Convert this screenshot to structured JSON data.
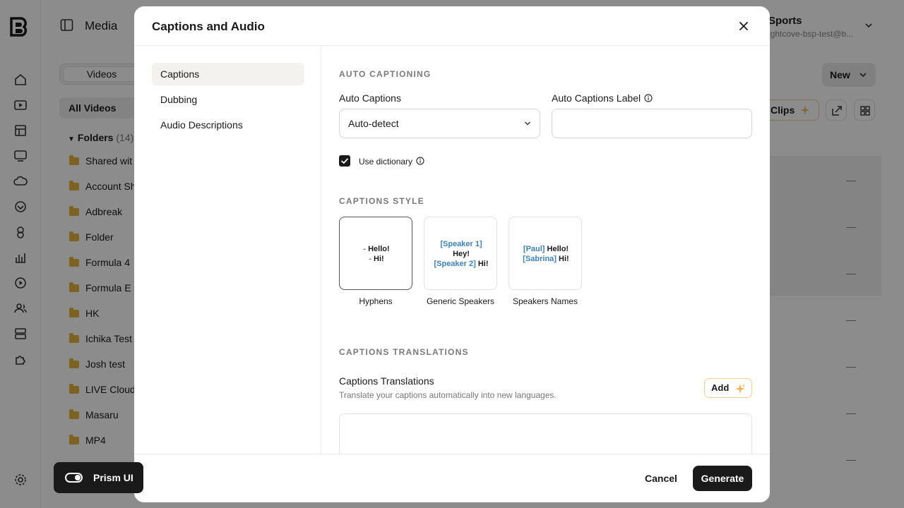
{
  "app": {
    "section_title": "Media",
    "tabs": {
      "active": "Videos"
    },
    "all_videos": "All Videos",
    "folders": {
      "label": "Folders",
      "count": "(14)",
      "items": [
        "Shared wit",
        "Account Sh",
        "Adbreak",
        "Folder",
        "Formula 4",
        "Formula E",
        "HK",
        "Ichika Test",
        "Josh test",
        "LIVE Cloud",
        "Masaru",
        "MP4"
      ]
    },
    "account": {
      "name": "Sports",
      "email": "ightcove-bsp-test@b..."
    },
    "new_button": "New",
    "clips_button": "Clips",
    "row_placeholder": "—",
    "prism_label": "Prism UI"
  },
  "modal": {
    "title": "Captions and Audio",
    "nav": [
      "Captions",
      "Dubbing",
      "Audio Descriptions"
    ],
    "auto_captioning": {
      "section": "AUTO CAPTIONING",
      "auto_captions_label": "Auto Captions",
      "auto_captions_value": "Auto-detect",
      "label_field_label": "Auto Captions Label",
      "label_field_value": "",
      "use_dictionary": "Use dictionary"
    },
    "captions_style": {
      "section": "CAPTIONS STYLE",
      "hyphens": {
        "name": "Hyphens",
        "line1": "Hello!",
        "line2": "Hi!",
        "dash": "-"
      },
      "generic": {
        "name": "Generic Speakers",
        "speaker1": "[Speaker 1]",
        "line1": "Hey!",
        "speaker2": "[Speaker 2]",
        "line2": "Hi!"
      },
      "names": {
        "name": "Speakers Names",
        "speaker1": "[Paul]",
        "line1": "Hello!",
        "speaker2": "[Sabrina]",
        "line2": "Hi!"
      }
    },
    "translations": {
      "section": "CAPTIONS TRANSLATIONS",
      "label": "Captions Translations",
      "help": "Translate your captions automatically into new languages.",
      "add_button": "Add"
    },
    "footer": {
      "cancel": "Cancel",
      "generate": "Generate"
    }
  },
  "colors": {
    "accent_blue": "#3b82c4",
    "overlay": "#000000",
    "folder": "#e3b23c",
    "primary": "#1a1a1a"
  }
}
